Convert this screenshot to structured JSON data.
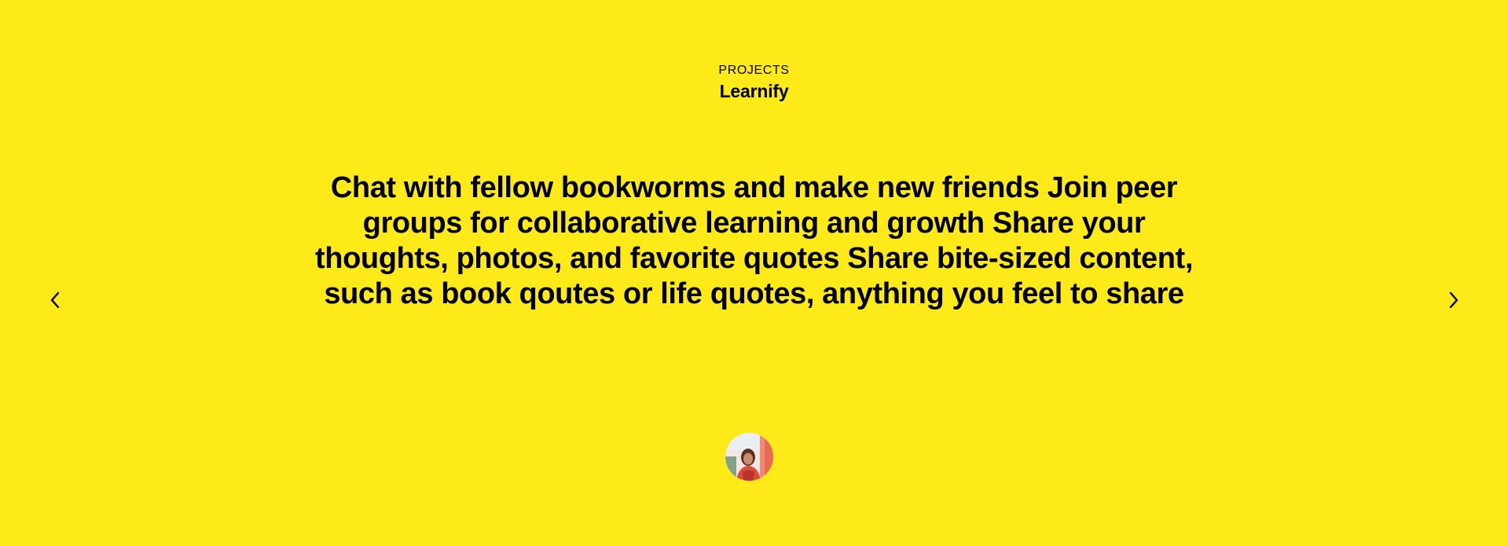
{
  "section": {
    "eyebrow": "PROJECTS",
    "title": "Learnify"
  },
  "slide": {
    "quote": "Chat with fellow bookworms and make new friends Join peer groups for collaborative learning and growth Share your thoughts, photos, and favorite quotes Share bite-sized content, such as book qoutes or life quotes, anything you feel to share"
  },
  "navigation": {
    "prev_icon": "chevron-left-icon",
    "next_icon": "chevron-right-icon"
  },
  "avatar": {
    "icon": "user-photo-avatar"
  },
  "colors": {
    "background": "#fee919",
    "text": "#000000"
  }
}
